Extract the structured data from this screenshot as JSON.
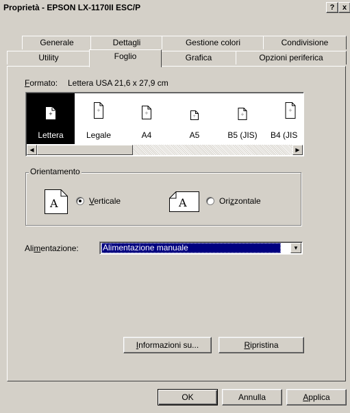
{
  "window": {
    "title": "Proprietà - EPSON LX-1170II ESC/P",
    "help_button": "?",
    "close_button": "x"
  },
  "tabs": {
    "row1": [
      "Generale",
      "Dettagli",
      "Gestione colori",
      "Condivisione"
    ],
    "row2": [
      "Utility",
      "Foglio",
      "Grafica",
      "Opzioni periferica"
    ],
    "active": "Foglio"
  },
  "format": {
    "label_accel": "F",
    "label_rest": "ormato:",
    "value": "Lettera USA 21,6 x 27,9 cm"
  },
  "papers": [
    {
      "label": "Lettera",
      "selected": true
    },
    {
      "label": "Legale",
      "selected": false
    },
    {
      "label": "A4",
      "selected": false
    },
    {
      "label": "A5",
      "selected": false
    },
    {
      "label": "B5 (JIS)",
      "selected": false
    },
    {
      "label": "B4 (JIS",
      "selected": false
    }
  ],
  "orientation": {
    "title": "Orientamento",
    "icon_letter": "A",
    "portrait_accel": "V",
    "portrait_rest": "erticale",
    "landscape_pre": "Ori",
    "landscape_accel": "z",
    "landscape_rest": "zontale",
    "selected": "Verticale"
  },
  "paper_source": {
    "label_pre": "Ali",
    "label_accel": "m",
    "label_rest": "entazione:",
    "value": "Alimentazione manuale"
  },
  "panel_buttons": {
    "info_accel": "I",
    "info_rest": "nformazioni su...",
    "restore_accel": "R",
    "restore_rest": "ipristina"
  },
  "dialog_buttons": {
    "ok": "OK",
    "cancel": "Annulla",
    "apply_accel": "A",
    "apply_rest": "pplica"
  }
}
